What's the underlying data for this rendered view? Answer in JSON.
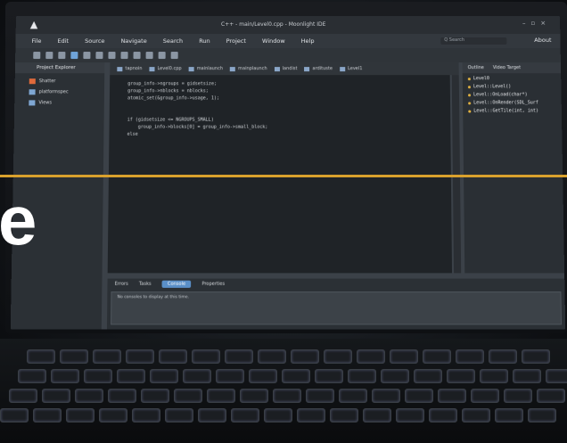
{
  "window": {
    "title": "C++ - main/Level0.cpp - Moonlight IDE",
    "logo_icon": "logo-triangle-icon",
    "controls_icons": [
      "minimize-icon",
      "maximize-icon",
      "close-icon"
    ]
  },
  "menubar": {
    "items": [
      "File",
      "Edit",
      "Source",
      "Navigate",
      "Search",
      "Run",
      "Project",
      "Window",
      "Help"
    ],
    "search_placeholder": "Q Search",
    "about": "About"
  },
  "sidebar": {
    "title": "Project Explorer",
    "items": [
      "Shatter",
      "platformspec",
      "Views"
    ]
  },
  "editor": {
    "tabs": [
      "tapnoin",
      "Level0.cpp",
      "mainlaunch",
      "mainplaunch",
      "landist",
      "ardituste",
      "Level1"
    ],
    "code_lines": [
      "group_info->ngroups = gidsetsize;",
      "group_info->nblocks = nblocks;",
      "atomic_set(&group_info->usage, 1);",
      "",
      "",
      "if (gidsetsize <= NGROUPS_SMALL)",
      "    group_info->blocks[0] = group_info->small_block;",
      "else"
    ]
  },
  "outline": {
    "tabs": [
      "Outline",
      "Video Target"
    ],
    "items": [
      "Level0",
      "Level::Level()",
      "Level::OnLoad(char*)",
      "Level::OnRender(SDL_Surf",
      "Level::GetTile(int, int)"
    ]
  },
  "bottom": {
    "tabs": [
      "Errors",
      "Tasks",
      "Console",
      "Properties"
    ],
    "active_tab": "Console",
    "console_text": "No consoles to display at this time."
  },
  "overlay": {
    "glyph": "e",
    "line_color": "#d9a12d"
  }
}
